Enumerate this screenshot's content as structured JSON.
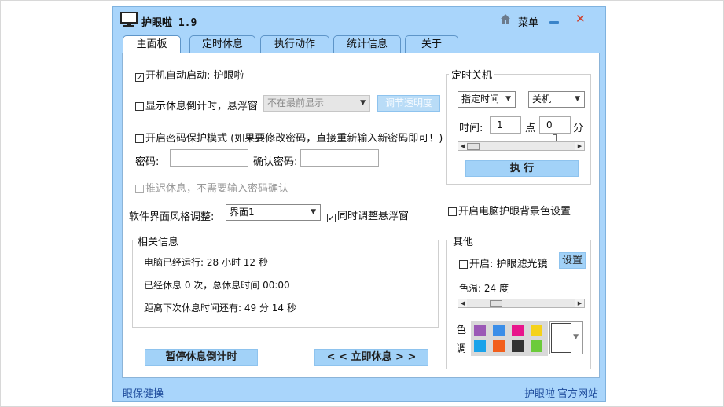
{
  "window": {
    "title": "护眼啦 1.9",
    "menu_label": "菜单"
  },
  "tabs": [
    {
      "label": "主面板"
    },
    {
      "label": "定时休息"
    },
    {
      "label": "执行动作"
    },
    {
      "label": "统计信息"
    },
    {
      "label": "关于"
    }
  ],
  "main": {
    "autostart_label": "开机自动启动: 护眼啦",
    "autostart_checked": "✓",
    "float_label": "显示休息倒计时，悬浮窗",
    "float_select_value": "不在最前显示",
    "transparency_button": "调节透明度",
    "password_mode_label": "开启密码保护模式 (如果要修改密码，直接重新输入新密码即可！)",
    "password_label": "密码:",
    "confirm_password_label": "确认密码:",
    "delay_rest_label": "推迟休息，不需要输入密码确认",
    "style_label": "软件界面风格调整:",
    "style_select_value": "界面1",
    "sync_float_label": "同时调整悬浮窗",
    "sync_float_checked": "✓",
    "pause_button": "暂停休息倒计时",
    "rest_now_button": "< < 立即休息 > >"
  },
  "info": {
    "title": "相关信息",
    "uptime": "电脑已经运行: 28 小时 12 秒",
    "rest_count": "已经休息 0 次，总休息时间 00:00",
    "next_rest": "距离下次休息时间还有: 49 分 14 秒"
  },
  "shutdown": {
    "title": "定时关机",
    "mode_value": "指定时间",
    "action_value": "关机",
    "time_label": "时间:",
    "hour_value": "1",
    "hour_unit": "点",
    "minute_value": "0",
    "minute_unit": "分",
    "slider_fraction": 0.0,
    "execute_button": "执 行"
  },
  "background_label": "开启电脑护眼背景色设置",
  "other": {
    "title": "其他",
    "filter_label": "开启: 护眼滤光镜",
    "settings_button": "设置",
    "temperature_label": "色温: 24 度",
    "temperature_fraction": 0.24,
    "tone_label_1": "色",
    "tone_label_2": "调",
    "swatches": [
      "#9b59b6",
      "#3b8ee8",
      "#e8168c",
      "#f5d21a",
      "#1aa3ea",
      "#f25f1c",
      "#333333",
      "#6ccb3b"
    ]
  },
  "status": {
    "left": "眼保健操",
    "right_1": "护眼啦",
    "right_2": "官方网站"
  }
}
